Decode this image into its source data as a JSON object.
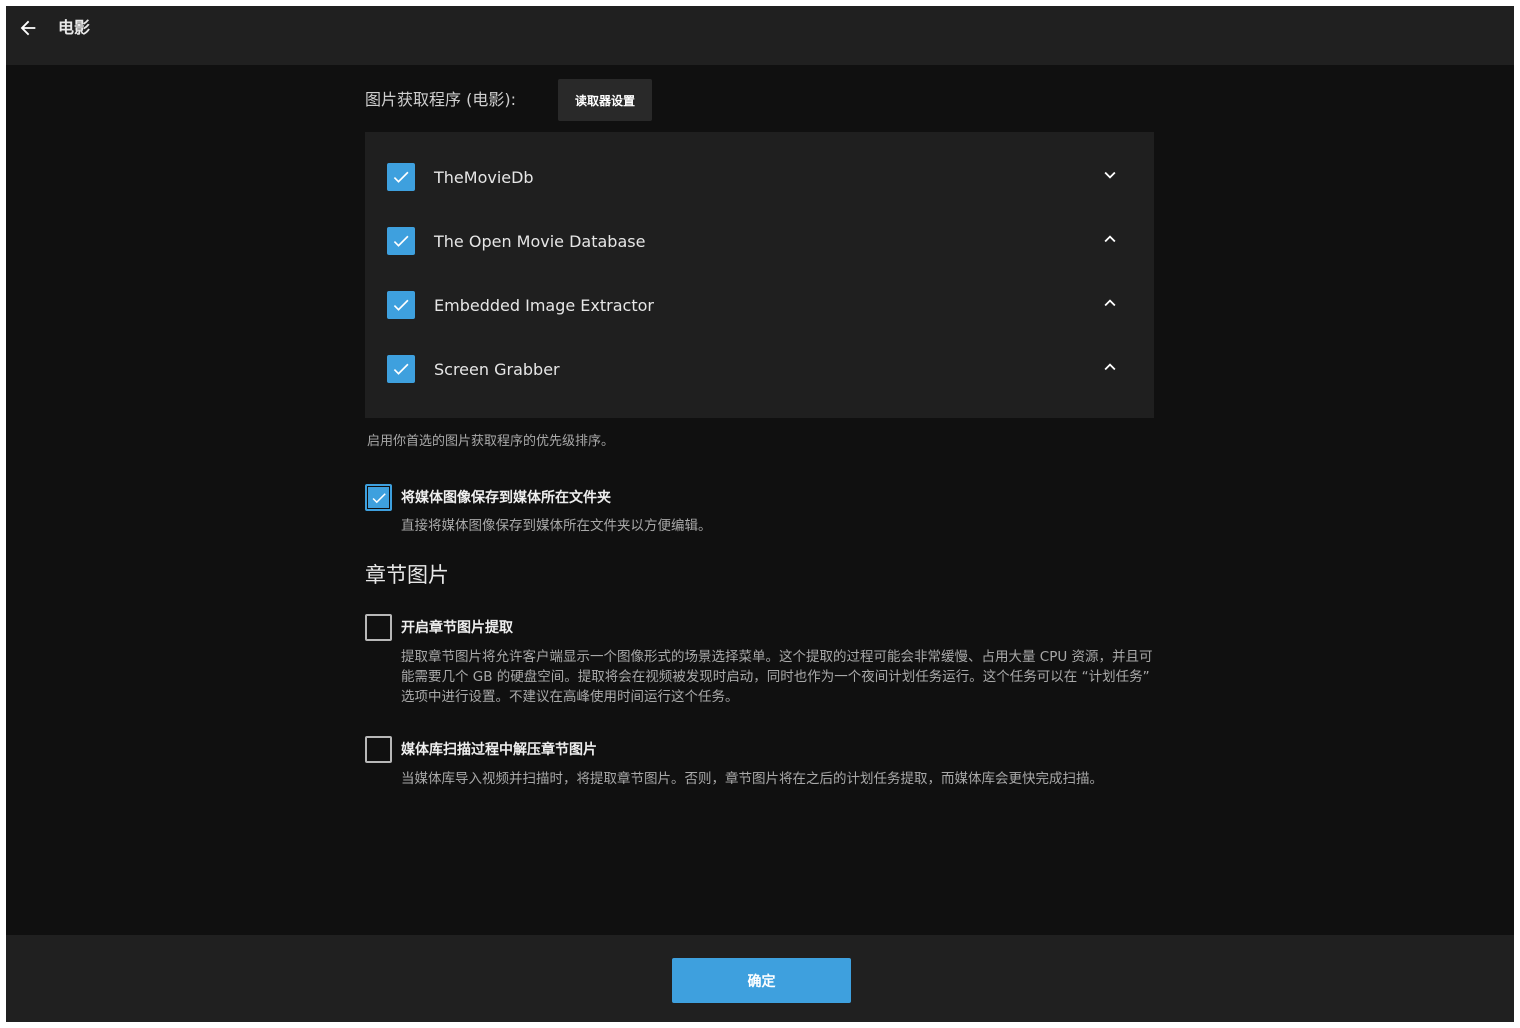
{
  "header": {
    "title": "电影",
    "back_icon": "arrow-left-icon"
  },
  "fetchers": {
    "label": "图片获取程序 (电影):",
    "reader_settings_label": "读取器设置",
    "items": [
      {
        "label": "TheMovieDb",
        "checked": true,
        "arrow": "chevron-down-icon"
      },
      {
        "label": "The Open Movie Database",
        "checked": true,
        "arrow": "chevron-up-icon"
      },
      {
        "label": "Embedded Image Extractor",
        "checked": true,
        "arrow": "chevron-up-icon"
      },
      {
        "label": "Screen Grabber",
        "checked": true,
        "arrow": "chevron-up-icon"
      }
    ],
    "help": "启用你首选的图片获取程序的优先级排序。"
  },
  "save_local": {
    "checked": true,
    "label": "将媒体图像保存到媒体所在文件夹",
    "description": "直接将媒体图像保存到媒体所在文件夹以方便编辑。"
  },
  "chapter_images": {
    "title": "章节图片",
    "extract": {
      "checked": false,
      "label": "开启章节图片提取",
      "description": "提取章节图片将允许客户端显示一个图像形式的场景选择菜单。这个提取的过程可能会非常缓慢、占用大量 CPU 资源，并且可能需要几个 GB 的硬盘空间。提取将会在视频被发现时启动，同时也作为一个夜间计划任务运行。这个任务可以在 “计划任务” 选项中进行设置。不建议在高峰使用时间运行这个任务。"
    },
    "during_scan": {
      "checked": false,
      "label": "媒体库扫描过程中解压章节图片",
      "description": "当媒体库导入视频并扫描时，将提取章节图片。否则，章节图片将在之后的计划任务提取，而媒体库会更快完成扫描。"
    }
  },
  "footer": {
    "ok_label": "确定"
  },
  "colors": {
    "accent": "#3ea0de",
    "background": "#101010",
    "header": "#202020",
    "panel": "#1f1f1f"
  }
}
